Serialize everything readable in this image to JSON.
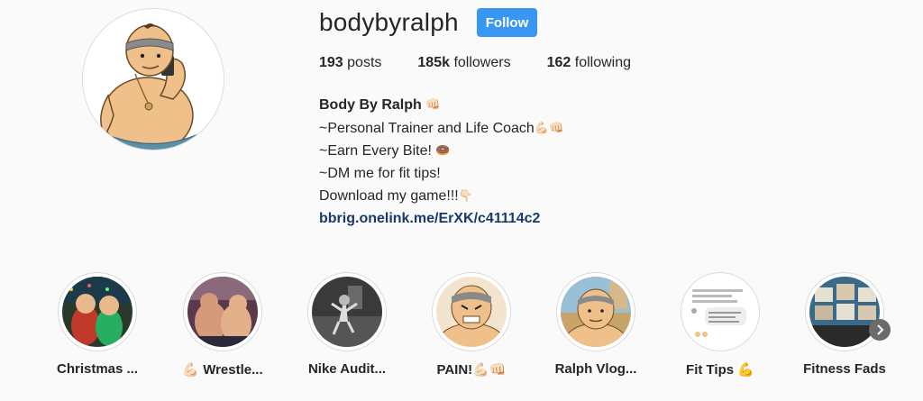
{
  "profile": {
    "username": "bodybyralph",
    "follow_label": "Follow",
    "stats": {
      "posts_count": "193",
      "posts_label": "posts",
      "followers_count": "185k",
      "followers_label": "followers",
      "following_count": "162",
      "following_label": "following"
    },
    "bio": {
      "full_name": "Body By Ralph",
      "full_name_emoji": "👊🏻",
      "line1": "~Personal Trainer and Life Coach",
      "line1_emoji": "💪🏻👊🏻",
      "line2": "~Earn Every Bite!",
      "line2_emoji": "🍩",
      "line3": "~DM me for fit tips!",
      "line4": "Download my game!!!",
      "line4_emoji": "👇🏻",
      "link": "bbrig.onelink.me/ErXK/c41114c2"
    }
  },
  "highlights": [
    {
      "label": "Christmas ...",
      "icon": "christmas-highlight-icon"
    },
    {
      "label": "💪🏻 Wrestle...",
      "icon": "wrestling-highlight-icon"
    },
    {
      "label": "Nike Audit...",
      "icon": "nike-audition-highlight-icon"
    },
    {
      "label": "PAIN!💪🏻👊🏻",
      "icon": "pain-highlight-icon"
    },
    {
      "label": "Ralph Vlog...",
      "icon": "vlog-highlight-icon"
    },
    {
      "label": "Fit Tips 💪",
      "icon": "fit-tips-highlight-icon"
    },
    {
      "label": "Fitness Fads",
      "icon": "fitness-fads-highlight-icon"
    }
  ],
  "icons": {
    "next_arrow": "chevron-right-icon",
    "avatar": "ralph-cartoon-avatar"
  },
  "colors": {
    "follow_button": "#3897f0",
    "link": "#1a3a6b",
    "background": "#fafafa"
  }
}
